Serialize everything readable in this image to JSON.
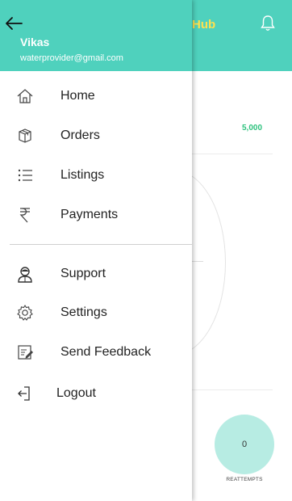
{
  "app": {
    "title": "Hub",
    "amount": "5,000",
    "circle_value": "0",
    "circle_label": "REATTEMPTS"
  },
  "drawer": {
    "user": {
      "name": "Vikas",
      "email": "waterprovider@gmail.com"
    },
    "items": [
      {
        "label": "Home",
        "icon": "home-icon"
      },
      {
        "label": "Orders",
        "icon": "box-icon"
      },
      {
        "label": "Listings",
        "icon": "list-icon"
      },
      {
        "label": "Payments",
        "icon": "rupee-icon"
      }
    ],
    "items_secondary": [
      {
        "label": "Support",
        "icon": "support-agent-icon"
      },
      {
        "label": "Settings",
        "icon": "gear-icon"
      },
      {
        "label": "Send Feedback",
        "icon": "feedback-icon"
      },
      {
        "label": "Logout",
        "icon": "logout-icon"
      }
    ]
  },
  "colors": {
    "header": "#4fd1bd",
    "title": "#ffe14d",
    "amount": "#2ec27e",
    "circle": "#b7ece3"
  }
}
